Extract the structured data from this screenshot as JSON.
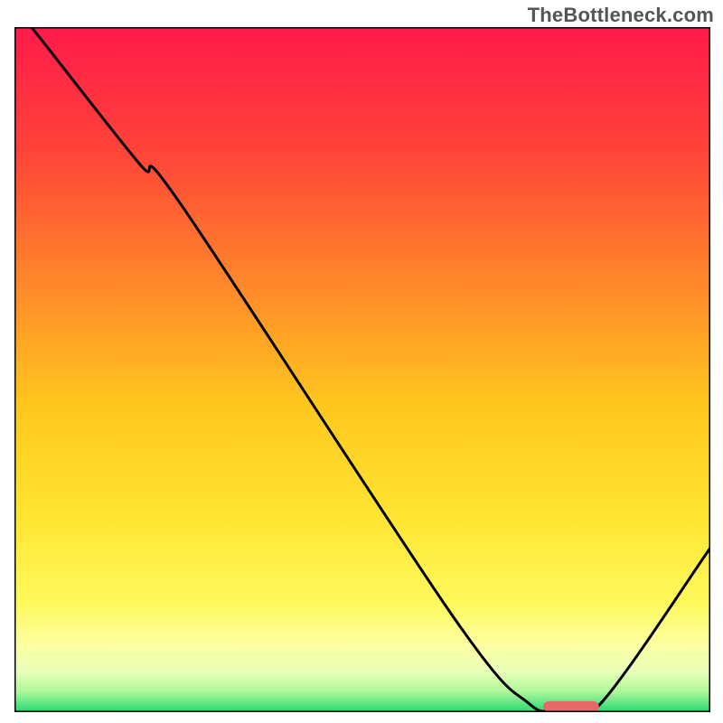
{
  "watermark": "TheBottleneck.com",
  "chart_data": {
    "type": "line",
    "title": "",
    "xlabel": "",
    "ylabel": "",
    "xlim": [
      0,
      100
    ],
    "ylim": [
      0,
      100
    ],
    "grid": false,
    "gradient_stops": [
      {
        "offset": 0.0,
        "color": "#ff1a4b"
      },
      {
        "offset": 0.18,
        "color": "#ff4338"
      },
      {
        "offset": 0.38,
        "color": "#ff8a2a"
      },
      {
        "offset": 0.55,
        "color": "#ffc61e"
      },
      {
        "offset": 0.72,
        "color": "#ffe633"
      },
      {
        "offset": 0.84,
        "color": "#fff95c"
      },
      {
        "offset": 0.9,
        "color": "#fdffa0"
      },
      {
        "offset": 0.94,
        "color": "#e9ffb8"
      },
      {
        "offset": 0.97,
        "color": "#aef79a"
      },
      {
        "offset": 1.0,
        "color": "#24d86f"
      }
    ],
    "series": [
      {
        "name": "bottleneck-curve",
        "color": "#000000",
        "x": [
          0.0,
          4,
          18,
          24,
          63,
          74,
          78,
          84,
          100
        ],
        "y": [
          103,
          98,
          80,
          74,
          14,
          1.2,
          0.8,
          1.0,
          24
        ]
      }
    ],
    "marker": {
      "name": "optimal-range",
      "color": "#e46a6a",
      "x_start": 76,
      "x_end": 84,
      "y": 0.8,
      "thickness": 1.6
    },
    "frame_color": "#000000",
    "frame_width": 2
  }
}
